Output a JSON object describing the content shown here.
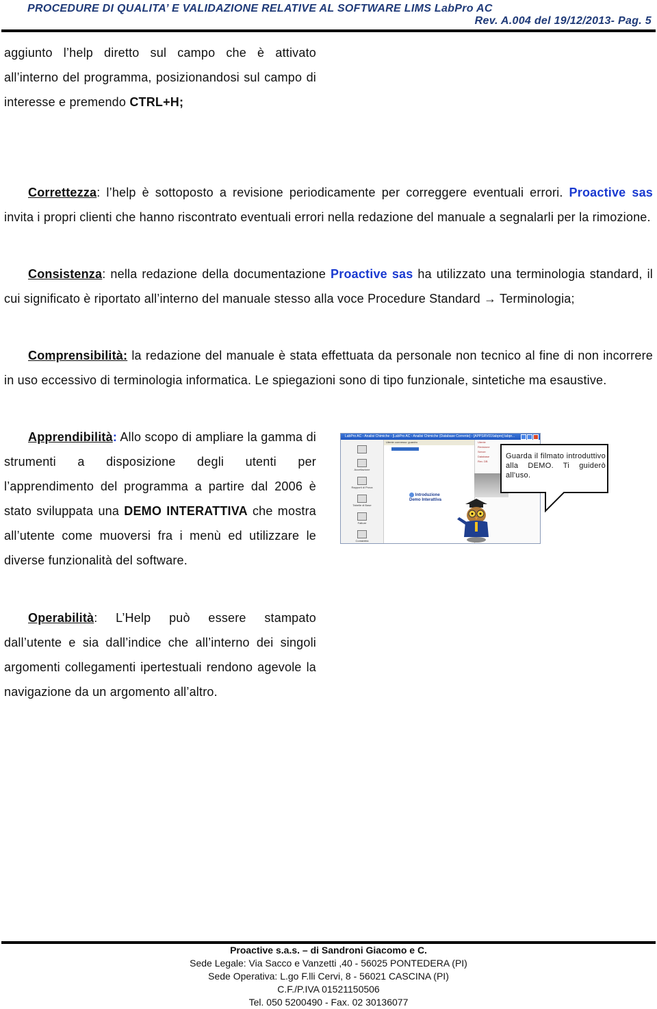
{
  "header": {
    "title": "PROCEDURE DI QUALITA’ E VALIDAZIONE RELATIVE AL SOFTWARE LIMS LabPro AC",
    "revision": "Rev. A.004 del 19/12/2013- Pag. 5"
  },
  "intro": {
    "text": "aggiunto l’help diretto sul campo che è attivato all’interno del programma, posizionandosi sul campo di interesse e premendo ",
    "shortcut": "CTRL+H;"
  },
  "correttezza": {
    "term": "Correttezza",
    "sep": ":",
    "text_a": " l’help è sottoposto a revisione periodicamente per correggere eventuali errori. ",
    "brand": "Proactive sas",
    "text_b": " invita i propri clienti che hanno riscontrato eventuali errori nella redazione del manuale a segnalarli per la rimozione."
  },
  "consistenza": {
    "term": "Consistenza",
    "sep": ":",
    "text_a": " nella redazione della documentazione ",
    "brand": "Proactive sas",
    "text_b": " ha utilizzato una terminologia standard, il cui significato è riportato all’interno del manuale stesso alla voce Procedure Standard → Terminologia;"
  },
  "comprensibilita": {
    "term": "Comprensibilità:",
    "text": " la redazione del manuale è stata effettuata da personale non tecnico al fine di non incorrere in uso eccessivo di terminologia informatica. Le spiegazioni sono di tipo funzionale, sintetiche ma esaustive."
  },
  "apprendibilita": {
    "term": "Apprendibilità",
    "sep": ":",
    "text_a": " Allo scopo di ampliare la gamma di strumenti a disposizione degli utenti per l’apprendimento del programma a partire dal 2006 è stato sviluppata una ",
    "highlight": "DEMO INTERATTIVA",
    "text_b": " che mostra all’utente come muoversi fra i menù ed utilizzare le diverse funzionalità del software."
  },
  "demo_screenshot": {
    "window_title": "LabPro AC - Analisi Chimiche - [LabPro AC - Analisi Chimiche (Database Corrente) - [APPSRV01\\labpro] labpr...",
    "tree_header": "Utente connesso: guardro",
    "side_items": [
      "",
      "Accettazione",
      "Rapporti di Prova",
      "Tabelle di Base",
      "Fatture",
      "Contabilità"
    ],
    "info_rows": [
      "Utente",
      "Revisione",
      "Server",
      "Database",
      "Rev. DB"
    ],
    "intro_line1": "Introduzione",
    "intro_line2": "Demo Interattiva",
    "bubble_text": "Guarda il filmato introduttivo alla DEMO. Ti guiderò all'uso."
  },
  "operabilita": {
    "term": "Operabilità",
    "sep": ":",
    "text": " L’Help può essere stampato dall’utente e sia dall’indice che all’interno dei singoli argomenti collegamenti ipertestuali rendono agevole la navigazione da un argomento all’altro."
  },
  "footer": {
    "company": "Proactive s.a.s. – di Sandroni Giacomo e C.",
    "legal": "Sede Legale: Via Sacco e Vanzetti ,40 - 56025 PONTEDERA (PI)",
    "operative": "Sede Operativa: L.go F.lli Cervi, 8 - 56021 CASCINA (PI)",
    "vat": "C.F./P.IVA 01521150506",
    "contacts": "Tel. 050 5200490 - Fax. 02 30136077"
  }
}
